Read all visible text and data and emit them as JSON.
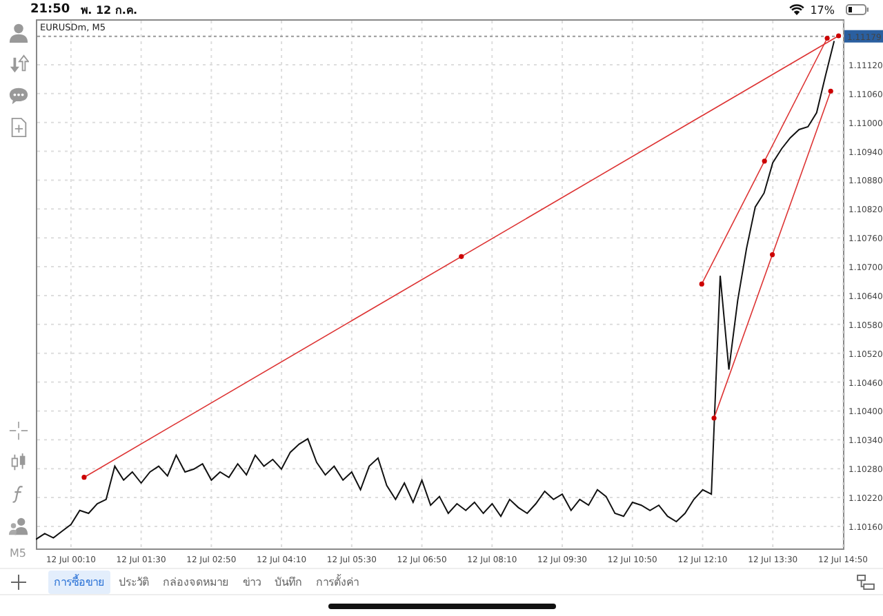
{
  "status_bar": {
    "time": "21:50",
    "date": "พ. 12 ก.ค.",
    "battery": "17%"
  },
  "toolbar": {
    "timeframe": "M5"
  },
  "chart": {
    "current_price": "1.11179",
    "chart_data": {
      "type": "line",
      "title": "EURUSDm, M5",
      "categories": [
        null,
        null,
        null,
        null,
        "12 Jul 00:10",
        null,
        null,
        null,
        null,
        null,
        null,
        null,
        "12 Jul 01:30",
        null,
        null,
        null,
        null,
        null,
        null,
        null,
        "12 Jul 02:50",
        null,
        null,
        null,
        null,
        null,
        null,
        null,
        "12 Jul 04:10",
        null,
        null,
        null,
        null,
        null,
        null,
        null,
        "12 Jul 05:30",
        null,
        null,
        null,
        null,
        null,
        null,
        null,
        "12 Jul 06:50",
        null,
        null,
        null,
        null,
        null,
        null,
        null,
        "12 Jul 08:10",
        null,
        null,
        null,
        null,
        null,
        null,
        null,
        "12 Jul 09:30",
        null,
        null,
        null,
        null,
        null,
        null,
        null,
        "12 Jul 10:50",
        null,
        null,
        null,
        null,
        null,
        null,
        null,
        "12 Jul 12:10",
        null,
        null,
        null,
        null,
        null,
        null,
        null,
        "12 Jul 13:30",
        null,
        null,
        null,
        null,
        null,
        null,
        null,
        "12 Jul 14:50"
      ],
      "values": [
        1.10133,
        1.10145,
        1.10136,
        1.1015,
        1.10164,
        1.10193,
        1.10187,
        1.10207,
        1.10216,
        1.10285,
        1.10256,
        1.10273,
        1.1025,
        1.10273,
        1.10285,
        1.10265,
        1.10308,
        1.10273,
        1.10279,
        1.1029,
        1.10256,
        1.10273,
        1.10262,
        1.1029,
        1.10267,
        1.10308,
        1.10285,
        1.10299,
        1.10279,
        1.10314,
        1.10331,
        1.10342,
        1.10293,
        1.10267,
        1.10285,
        1.10256,
        1.10273,
        1.10236,
        1.10285,
        1.10302,
        1.10245,
        1.10216,
        1.1025,
        1.1021,
        1.10256,
        1.10204,
        1.10222,
        1.10187,
        1.10207,
        1.10193,
        1.1021,
        1.10187,
        1.10207,
        1.10181,
        1.10216,
        1.10199,
        1.10187,
        1.10207,
        1.10233,
        1.10216,
        1.10227,
        1.10193,
        1.10216,
        1.10204,
        1.10236,
        1.10222,
        1.10187,
        1.10181,
        1.1021,
        1.10204,
        1.10193,
        1.10204,
        1.10181,
        1.1017,
        1.10187,
        1.10216,
        1.10236,
        1.10227,
        1.10681,
        1.10486,
        1.1063,
        1.10738,
        1.10824,
        1.10853,
        1.10916,
        1.10945,
        1.10968,
        1.10985,
        1.10991,
        1.1102,
        1.11097,
        1.11169,
        null
      ],
      "ylim": [
        1.10114,
        1.1118
      ],
      "grid": true,
      "yticks": [
        {
          "value": 1.1016,
          "label": "1.10160"
        },
        {
          "value": 1.1022,
          "label": "1.10220"
        },
        {
          "value": 1.1028,
          "label": "1.10280"
        },
        {
          "value": 1.1034,
          "label": "1.10340"
        },
        {
          "value": 1.104,
          "label": "1.10400"
        },
        {
          "value": 1.1046,
          "label": "1.10460"
        },
        {
          "value": 1.1052,
          "label": "1.10520"
        },
        {
          "value": 1.1058,
          "label": "1.10580"
        },
        {
          "value": 1.1064,
          "label": "1.10640"
        },
        {
          "value": 1.107,
          "label": "1.10700"
        },
        {
          "value": 1.1076,
          "label": "1.10760"
        },
        {
          "value": 1.1082,
          "label": "1.10820"
        },
        {
          "value": 1.1088,
          "label": "1.10880"
        },
        {
          "value": 1.1094,
          "label": "1.10940"
        },
        {
          "value": 1.11,
          "label": "1.11000"
        },
        {
          "value": 1.1106,
          "label": "1.11060"
        },
        {
          "value": 1.1112,
          "label": "1.11120"
        }
      ]
    },
    "drawings": [
      {
        "kind": "trendline"
      },
      {
        "kind": "trendline"
      },
      {
        "kind": "trendline"
      }
    ]
  },
  "tabs": [
    {
      "label": "การซื้อขาย",
      "selected": true
    },
    {
      "label": "ประวัติ",
      "selected": false
    },
    {
      "label": "กล่องจดหมาย",
      "selected": false
    },
    {
      "label": "ข่าว",
      "selected": false
    },
    {
      "label": "บันทึก",
      "selected": false
    },
    {
      "label": "การตั้งค่า",
      "selected": false
    }
  ]
}
